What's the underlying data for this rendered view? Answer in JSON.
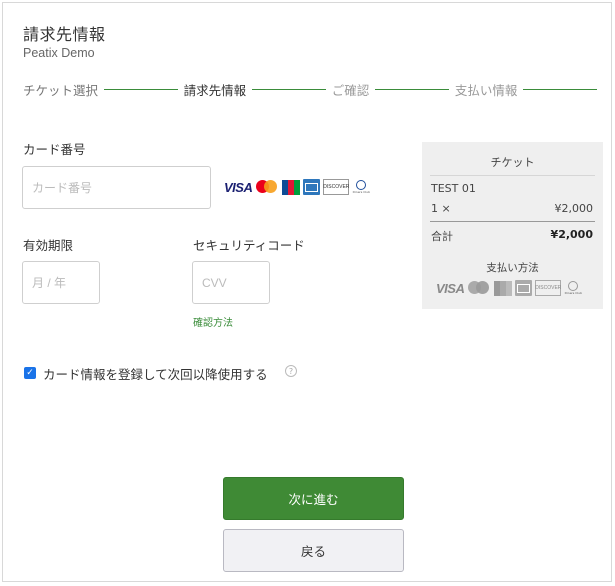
{
  "header": {
    "title": "請求先情報",
    "org": "Peatix Demo"
  },
  "stepper": {
    "steps": [
      "チケット選択",
      "請求先情報",
      "ご確認",
      "支払い情報"
    ]
  },
  "card_form": {
    "card_number_label": "カード番号",
    "card_number_placeholder": "カード番号",
    "expiry_label": "有効期限",
    "expiry_placeholder": "月 / 年",
    "cvv_label": "セキュリティコード",
    "cvv_placeholder": "CVV",
    "cvv_help_link": "確認方法",
    "brands": [
      "VISA",
      "Mastercard",
      "JCB",
      "American Express",
      "DISCOVER",
      "Diners Club"
    ],
    "save_card_label": "カード情報を登録して次回以降使用する",
    "save_card_checked": true
  },
  "summary": {
    "title": "チケット",
    "ticket_name": "TEST 01",
    "quantity": "1 ×",
    "price": "¥2,000",
    "total_label": "合計",
    "total_value": "¥2,000",
    "payment_methods_title": "支払い方法"
  },
  "actions": {
    "next": "次に進む",
    "back": "戻る"
  },
  "colors": {
    "accent": "#3f8a35",
    "checkbox": "#1a73e8",
    "summary_bg": "#efefef"
  }
}
